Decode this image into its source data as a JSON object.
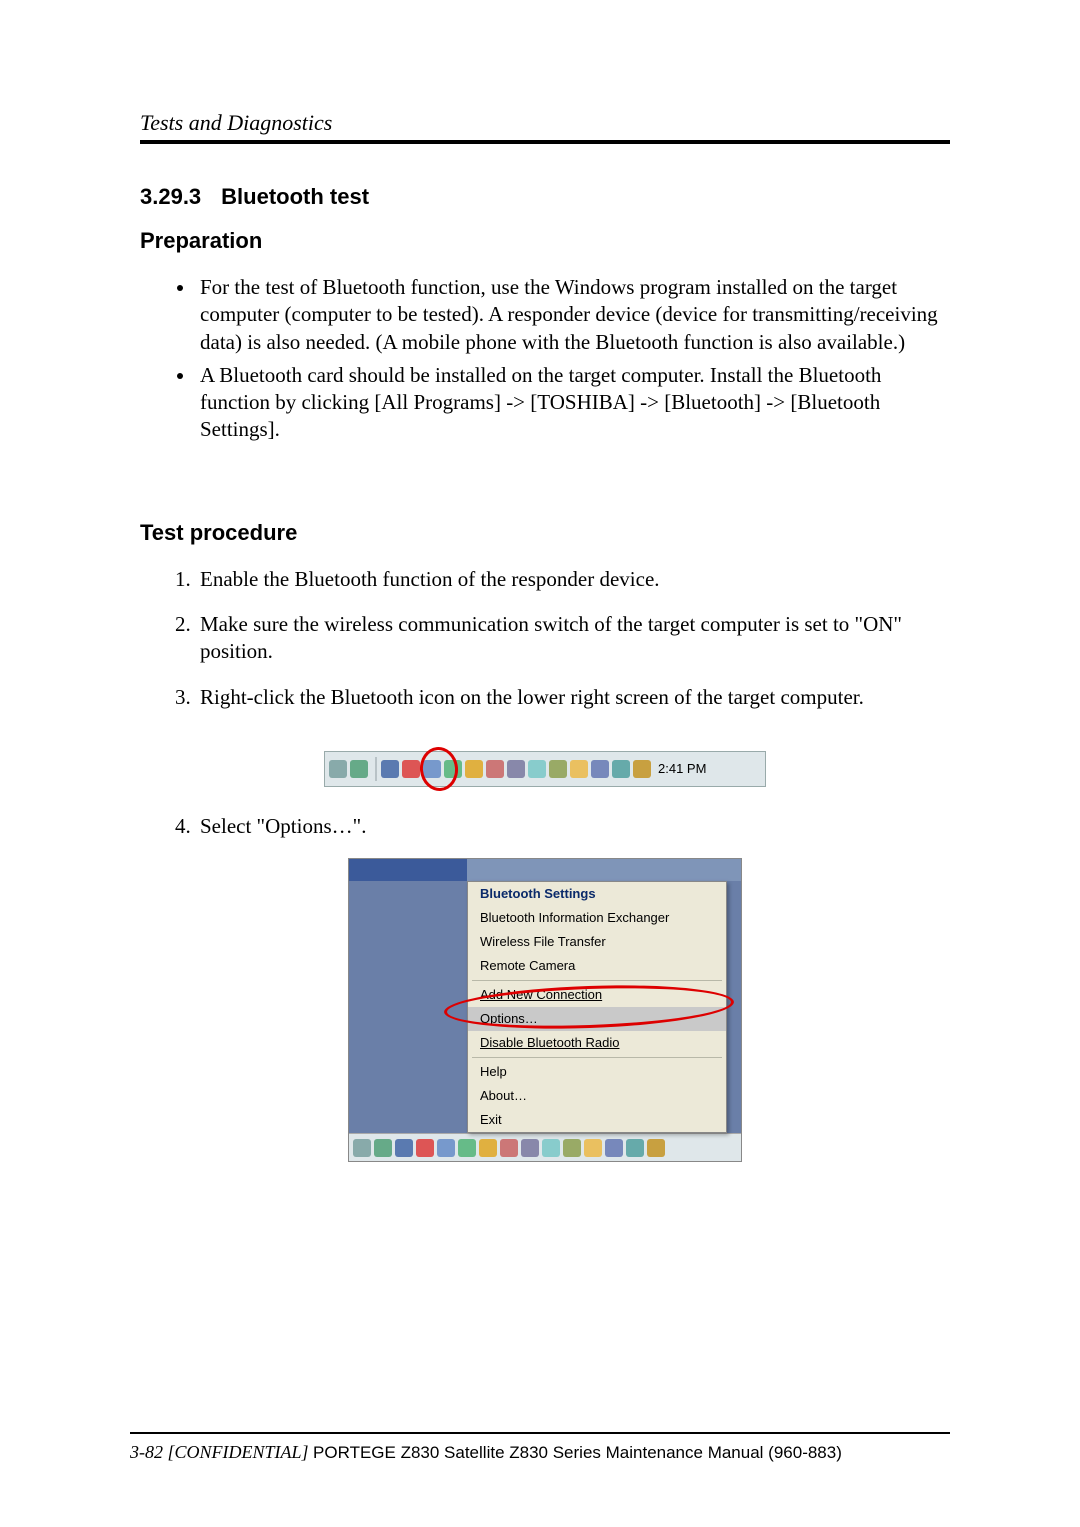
{
  "header": {
    "title": "Tests and Diagnostics"
  },
  "section": {
    "number": "3.29.3",
    "title": "Bluetooth test"
  },
  "preparation": {
    "heading": "Preparation",
    "bullets": [
      "For the test of Bluetooth function, use the Windows program installed on the target computer (computer to be tested). A responder device (device for transmitting/receiving data) is also needed. (A mobile phone with the Bluetooth function is also available.)",
      "A Bluetooth card should be installed on the target computer.  Install the Bluetooth function by clicking [All Programs] -> [TOSHIBA] -> [Bluetooth] -> [Bluetooth Settings]."
    ]
  },
  "procedure": {
    "heading": "Test procedure",
    "steps": [
      "Enable the Bluetooth function of the responder device.",
      "Make sure the wireless communication switch of the target computer is set to \"ON\" position.",
      "Right-click the Bluetooth icon on the lower right screen of the target computer.",
      "Select \"Options…\"."
    ]
  },
  "taskbar": {
    "clock": "2:41 PM",
    "tray_icons": [
      "pen-icon",
      "tablet-icon",
      "screen1-icon",
      "bluetooth-icon",
      "shield-icon",
      "vol1-icon",
      "vol2-icon",
      "vol3-icon",
      "net-icon",
      "display-icon",
      "chip-icon",
      "folder-icon",
      "fn-icon",
      "power-icon",
      "updates-icon"
    ]
  },
  "context_menu": {
    "items": [
      "Bluetooth Settings",
      "Bluetooth Information Exchanger",
      "Wireless File Transfer",
      "Remote Camera",
      "Add New Connection",
      "Options…",
      "Disable Bluetooth Radio",
      "Help",
      "About…",
      "Exit"
    ]
  },
  "footer": {
    "page": "3-82",
    "confidential": "[CONFIDENTIAL]",
    "rest": "PORTEGE Z830 Satellite Z830 Series Maintenance Manual (960-883)"
  },
  "icon_colors": [
    "#8aa",
    "#6a8",
    "#5a7ab0",
    "#d55",
    "#79c",
    "#6b8",
    "#e0b040",
    "#c77",
    "#88a",
    "#8cc",
    "#9a6",
    "#eac060",
    "#78b",
    "#6aa",
    "#c8a040"
  ]
}
